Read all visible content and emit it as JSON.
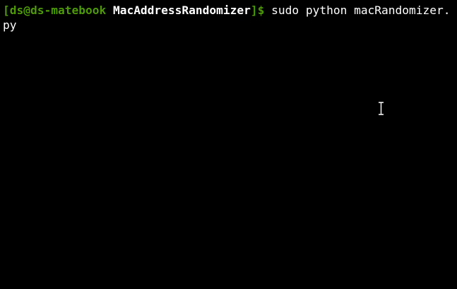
{
  "terminal": {
    "prompt": {
      "open_bracket": "[",
      "user": "ds",
      "at": "@",
      "host": "ds-matebook",
      "space": " ",
      "directory": "MacAddressRandomizer",
      "close_bracket": "]",
      "symbol": "$"
    },
    "command": " sudo python macRandomizer.py"
  },
  "colors": {
    "background": "#000000",
    "prompt_green": "#4e9a06",
    "text": "#ffffff"
  },
  "cursor": {
    "icon": "text-ibeam-cursor-icon"
  }
}
